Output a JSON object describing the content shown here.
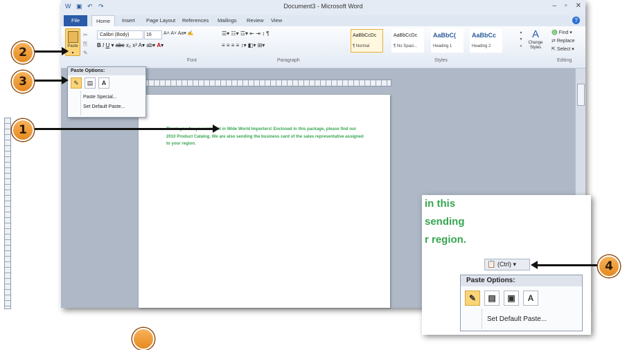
{
  "window": {
    "title": "Document3 - Microsoft Word"
  },
  "tabs": [
    "File",
    "Home",
    "Insert",
    "Page Layout",
    "References",
    "Mailings",
    "Review",
    "View"
  ],
  "ribbon": {
    "paste_label": "Paste",
    "font_name": "Calibri (Body)",
    "font_size": "16",
    "group_font": "Font",
    "group_paragraph": "Paragraph",
    "group_styles": "Styles",
    "group_editing": "Editing",
    "styles": [
      {
        "preview": "AaBbCcDc",
        "name": "¶ Normal"
      },
      {
        "preview": "AaBbCcDc",
        "name": "¶ No Spaci..."
      },
      {
        "preview": "AaBbC(",
        "name": "Heading 1"
      },
      {
        "preview": "AaBbCc",
        "name": "Heading 2"
      }
    ],
    "change_styles": "Change Styles",
    "find": "Find",
    "replace": "Replace",
    "select": "Select"
  },
  "paste_menu": {
    "header": "Paste Options:",
    "paste_special": "Paste Special...",
    "set_default": "Set Default Paste..."
  },
  "document": {
    "text": "Thank you for your interest in Wide World Importers! Enclosed in this package, please find our 2010 Product Catalog. We are also sending the business card of the sales representative assigned to your region."
  },
  "zoom": {
    "line1": "in this",
    "line2": "sending",
    "line3": "r region.",
    "ctrl_label": "(Ctrl) ▾",
    "header": "Paste Options:",
    "set_default": "Set Default Paste..."
  },
  "callouts": [
    "1",
    "2",
    "3",
    "4"
  ]
}
